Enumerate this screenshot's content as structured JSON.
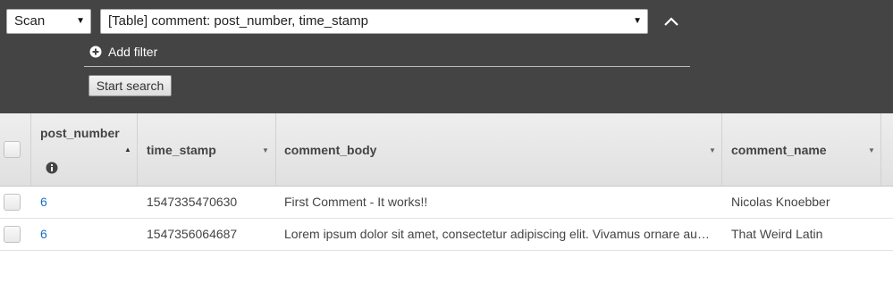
{
  "toolbar": {
    "scan_select": "Scan",
    "table_select": "[Table] comment: post_number, time_stamp",
    "add_filter": "Add filter",
    "start_search": "Start search"
  },
  "table": {
    "columns": [
      "post_number",
      "time_stamp",
      "comment_body",
      "comment_name"
    ],
    "rows": [
      {
        "post_number": "6",
        "time_stamp": "1547335470630",
        "comment_body": "First Comment - It works!!",
        "comment_name": "Nicolas Knoebber"
      },
      {
        "post_number": "6",
        "time_stamp": "1547356064687",
        "comment_body": "Lorem ipsum dolor sit amet, consectetur adipiscing elit. Vivamus ornare au…",
        "comment_name": "That Weird Latin"
      }
    ]
  },
  "colors": {
    "toolbar_bg": "#444444",
    "link": "#1a6fc2",
    "header_bg": "#e6e6e6"
  }
}
